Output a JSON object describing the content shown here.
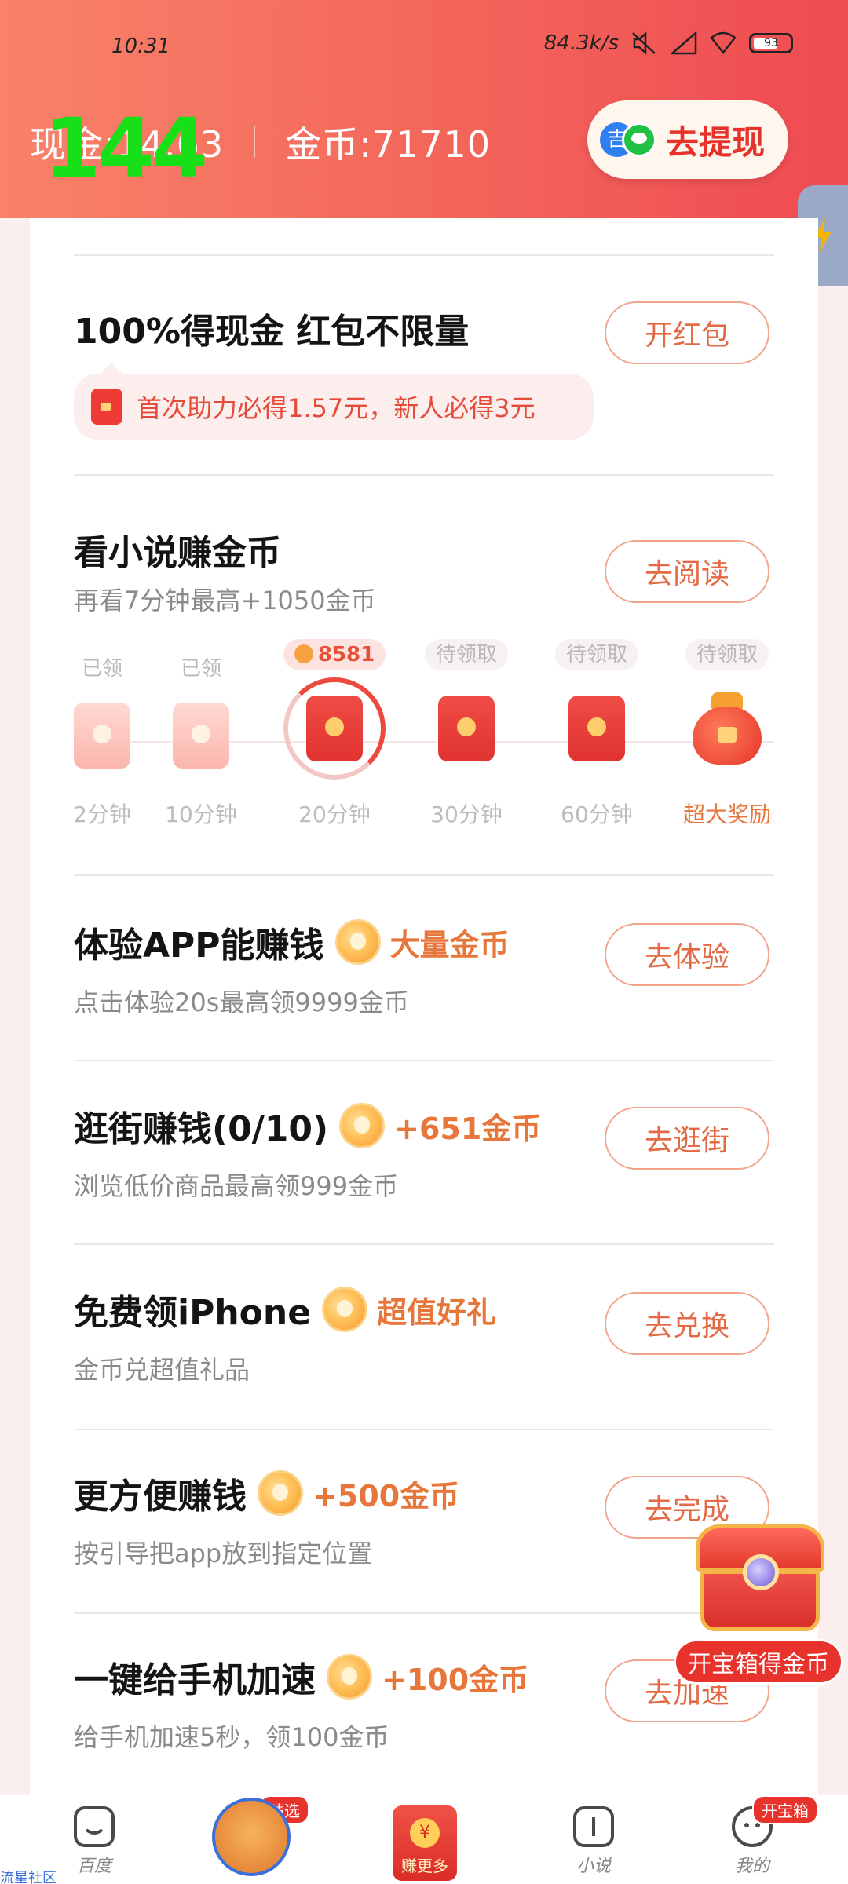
{
  "status_bar": {
    "time": "10:31",
    "speed": "84.3k/s",
    "battery": "93"
  },
  "header": {
    "cash_label": "现金:14.63",
    "coins_label": "金币:71710",
    "overlay_number": "144",
    "withdraw_label": "去提现",
    "withdraw_icon_text": "吉"
  },
  "tasks": {
    "redpacket": {
      "title": "100%得现金 红包不限量",
      "button": "开红包",
      "tip": "首次助力必得1.57元，新人必得3元"
    },
    "novel": {
      "title": "看小说赚金币",
      "subtitle": "再看7分钟最高+1050金币",
      "button": "去阅读",
      "steps": [
        {
          "status": "已领",
          "label": "2分钟",
          "state": "done"
        },
        {
          "status": "已领",
          "label": "10分钟",
          "state": "done"
        },
        {
          "status": "8581",
          "label": "20分钟",
          "state": "active"
        },
        {
          "status": "待领取",
          "label": "30分钟",
          "state": "locked"
        },
        {
          "status": "待领取",
          "label": "60分钟",
          "state": "locked"
        },
        {
          "status": "待领取",
          "label": "超大奖励",
          "state": "bag"
        }
      ]
    },
    "app_trial": {
      "title": "体验APP能赚钱",
      "badge": "大量金币",
      "subtitle": "点击体验20s最高领9999金币",
      "button": "去体验"
    },
    "shopping": {
      "title": "逛街赚钱(0/10)",
      "badge": "+651金币",
      "subtitle": "浏览低价商品最高领999金币",
      "button": "去逛街"
    },
    "iphone": {
      "title": "免费领iPhone",
      "badge": "超值好礼",
      "subtitle": "金币兑超值礼品",
      "button": "去兑换"
    },
    "convenient": {
      "title": "更方便赚钱",
      "badge": "+500金币",
      "subtitle": "按引导把app放到指定位置",
      "button": "去完成"
    },
    "speedup": {
      "title": "一键给手机加速",
      "badge": "+100金币",
      "subtitle": "给手机加速5秒，领100金币",
      "button": "去加速"
    }
  },
  "treasure": {
    "label": "开宝箱得金币"
  },
  "bottom_nav": {
    "home": "百度",
    "featured_badge": "精选",
    "earn": "赚更多",
    "earn_coin": "¥",
    "novel": "小说",
    "mine": "我的",
    "mine_badge": "开宝箱"
  },
  "corner_tag": "流星社区"
}
